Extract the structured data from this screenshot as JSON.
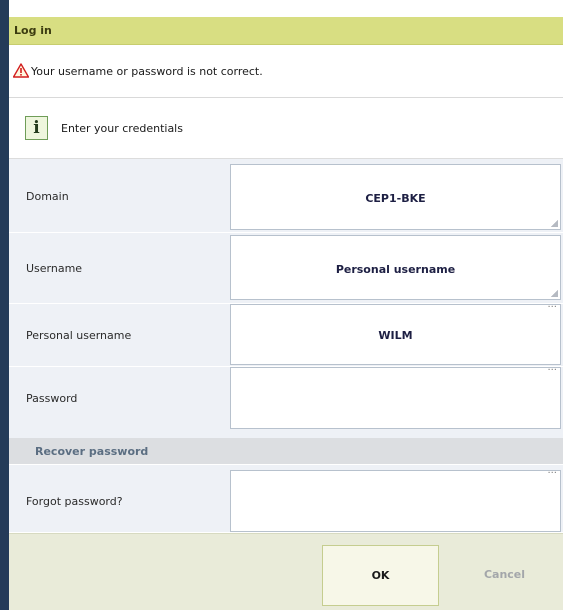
{
  "dialog": {
    "title": "Log in",
    "error_message": "Your username or password is not correct.",
    "info_message": "Enter your credentials"
  },
  "fields": {
    "domain": {
      "label": "Domain",
      "value": "CEP1-BKE"
    },
    "username": {
      "label": "Username",
      "value": "Personal username"
    },
    "personal_username": {
      "label": "Personal username",
      "value": "WILM"
    },
    "password": {
      "label": "Password",
      "value": ""
    }
  },
  "recover": {
    "section_title": "Recover password",
    "forgot_label": "Forgot password?",
    "forgot_value": ""
  },
  "buttons": {
    "ok": "OK",
    "cancel": "Cancel"
  },
  "icons": {
    "warning": "warning-triangle-icon",
    "info": "info-icon",
    "info_glyph": "i",
    "ellipsis": "...",
    "dropdown_corner": "dropdown-corner-icon"
  },
  "colors": {
    "title_bar": "#d8de82",
    "row_background": "#eef1f6",
    "section_header": "#dcdee1",
    "button_bar": "#e9ebd9",
    "screen_background": "#243b59",
    "warning": "#d21e1e",
    "value_text": "#1d1f43"
  }
}
